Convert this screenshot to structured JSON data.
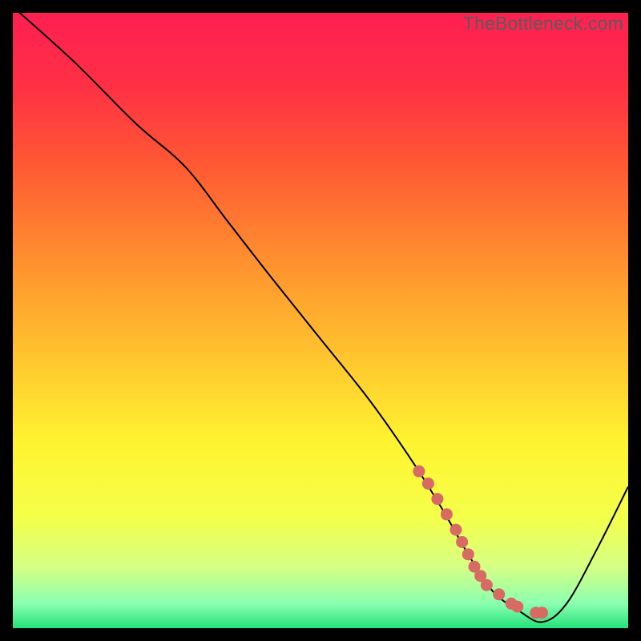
{
  "watermark": "TheBottleneck.com",
  "chart_data": {
    "type": "line",
    "title": "",
    "xlabel": "",
    "ylabel": "",
    "xlim": [
      0,
      100
    ],
    "ylim": [
      0,
      100
    ],
    "grid": false,
    "series": [
      {
        "name": "curve",
        "color": "#000000",
        "x": [
          0,
          10,
          20,
          28,
          35,
          42,
          50,
          58,
          65,
          70,
          74,
          78,
          82,
          86,
          90,
          95,
          100
        ],
        "y": [
          101,
          92,
          82,
          75,
          66,
          57,
          47,
          37,
          27,
          19,
          12,
          6,
          3,
          1,
          4,
          13,
          23
        ]
      },
      {
        "name": "highlight-dots",
        "type": "scatter",
        "color": "#d76a63",
        "x": [
          66,
          67.5,
          69,
          70.5,
          72,
          73,
          74,
          75,
          76,
          77,
          79,
          81,
          82,
          85,
          86
        ],
        "y": [
          25.5,
          23.5,
          21,
          18.5,
          16,
          14,
          12,
          10,
          8.5,
          7,
          5.5,
          4,
          3.5,
          2.5,
          2.5
        ]
      }
    ],
    "background_gradient": {
      "stops": [
        {
          "offset": 0.0,
          "color": "#ff1f53"
        },
        {
          "offset": 0.12,
          "color": "#ff3044"
        },
        {
          "offset": 0.25,
          "color": "#ff5a33"
        },
        {
          "offset": 0.4,
          "color": "#ff8f2f"
        },
        {
          "offset": 0.55,
          "color": "#ffc22e"
        },
        {
          "offset": 0.7,
          "color": "#fff430"
        },
        {
          "offset": 0.82,
          "color": "#f4ff4a"
        },
        {
          "offset": 0.9,
          "color": "#d6ff84"
        },
        {
          "offset": 0.96,
          "color": "#8bffb0"
        },
        {
          "offset": 1.0,
          "color": "#23e27a"
        }
      ]
    }
  }
}
